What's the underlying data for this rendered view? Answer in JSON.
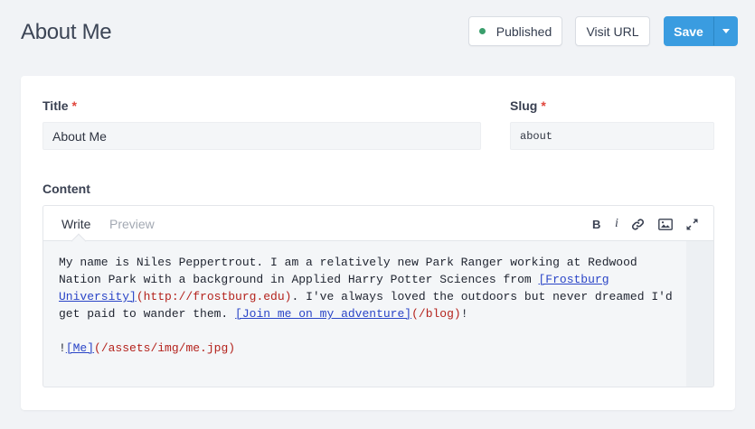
{
  "page": {
    "title": "About Me"
  },
  "toolbar": {
    "status_label": "Published",
    "visit_label": "Visit URL",
    "save_label": "Save"
  },
  "form": {
    "title_label": "Title",
    "title_value": "About Me",
    "slug_label": "Slug",
    "slug_value": "about",
    "required_mark": "*",
    "content_label": "Content"
  },
  "editor": {
    "tabs": [
      "Write",
      "Preview"
    ],
    "tools": [
      "bold-icon",
      "italic-icon",
      "link-icon",
      "image-icon",
      "fullscreen-icon"
    ],
    "bold_glyph": "B",
    "italic_glyph": "i",
    "lines": {
      "l1": "My name is Niles Peppertrout. I am a relatively new Park Ranger working at Redwood",
      "l2_text": "Nation Park with a background in Applied Harry Potter Sciences from ",
      "l2_link": "[Frostburg ",
      "l3_link": "University]",
      "l3_url": "(http://frostburg.edu)",
      "l3_text": ". I've always loved the outdoors but never dreamed I'd",
      "l4_text": "get paid to wander them. ",
      "l4_link": "[Join me on my adventure]",
      "l4_url": "(/blog)",
      "l4_end": "!",
      "l6_bang": "!",
      "l6_link": "[Me]",
      "l6_url": "(/assets/img/me.jpg)"
    }
  },
  "colors": {
    "accent": "#3a9ce0",
    "published_dot": "#3a9e6c",
    "required": "#e0453b",
    "md_link": "#2a45c7",
    "md_url": "#b4231d"
  }
}
